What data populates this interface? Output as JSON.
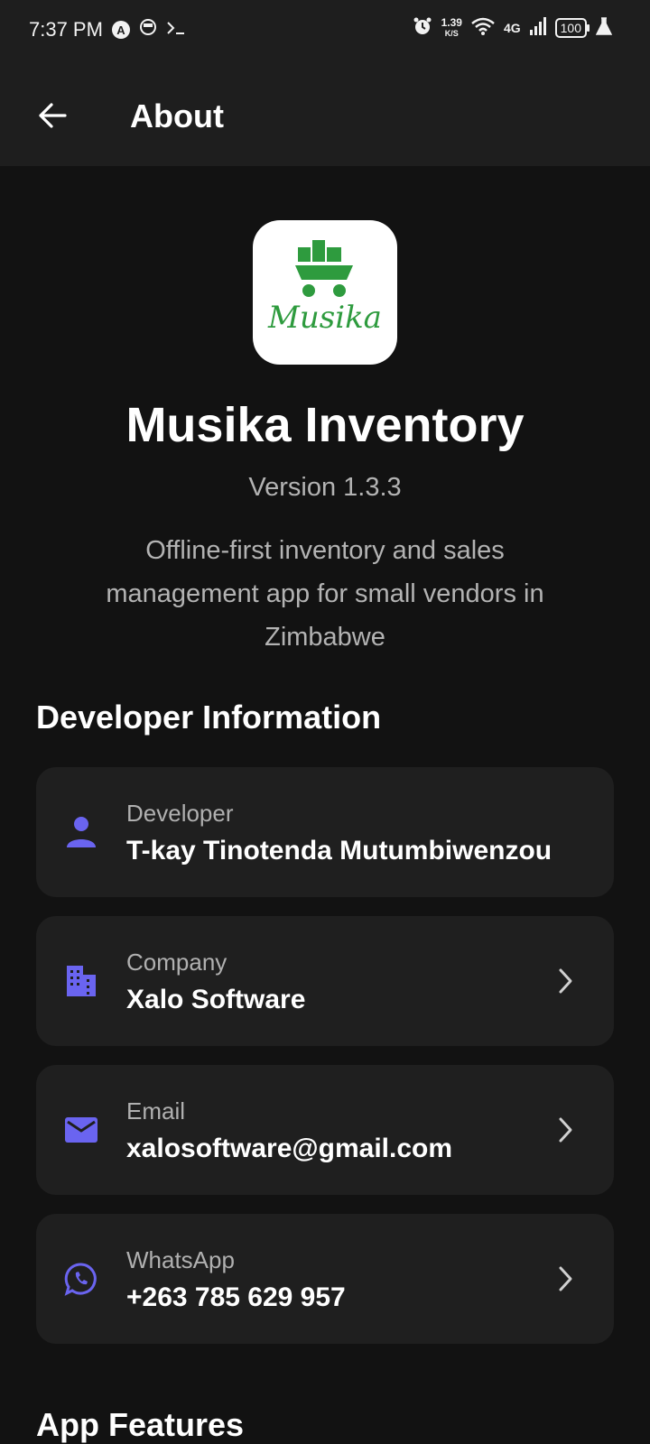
{
  "status_bar": {
    "time": "7:37 PM",
    "icons_left": [
      "app-icon",
      "notification-icon",
      "terminal-icon"
    ],
    "speed_value": "1.39",
    "speed_unit": "K/S",
    "network": "4G",
    "battery": "100"
  },
  "header": {
    "title": "About",
    "back_icon": "arrow-left-icon"
  },
  "app": {
    "logo_text": "Musika",
    "name": "Musika Inventory",
    "version": "Version 1.3.3",
    "description": "Offline-first inventory and sales management app for small vendors in Zimbabwe"
  },
  "developer_section": {
    "title": "Developer Information",
    "items": [
      {
        "label": "Developer",
        "value": "T-kay Tinotenda Mutumbiwenzou",
        "icon": "person-icon",
        "has_chevron": false
      },
      {
        "label": "Company",
        "value": "Xalo Software",
        "icon": "building-icon",
        "has_chevron": true
      },
      {
        "label": "Email",
        "value": "xalosoftware@gmail.com",
        "icon": "email-icon",
        "has_chevron": true
      },
      {
        "label": "WhatsApp",
        "value": "+263 785 629 957",
        "icon": "whatsapp-icon",
        "has_chevron": true
      }
    ]
  },
  "features_section": {
    "title": "App Features"
  },
  "colors": {
    "background": "#121212",
    "card": "#1f1f1f",
    "accent": "#6a64f0",
    "logo_green": "#2e9b3e"
  }
}
